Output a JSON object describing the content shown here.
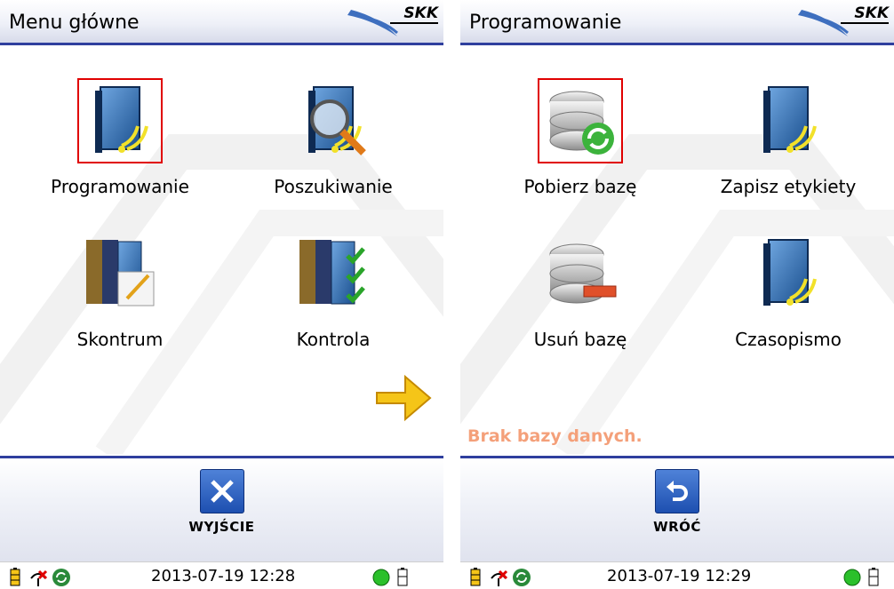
{
  "left": {
    "title": "Menu główne",
    "logo_text": "SKK",
    "tiles": [
      {
        "label": "Programowanie",
        "icon": "book-rfid-icon",
        "selected": true
      },
      {
        "label": "Poszukiwanie",
        "icon": "book-search-icon",
        "selected": false
      },
      {
        "label": "Skontrum",
        "icon": "books-edit-icon",
        "selected": false
      },
      {
        "label": "Kontrola",
        "icon": "books-check-icon",
        "selected": false
      }
    ],
    "next_icon": "arrow-right-icon",
    "bottom_button": {
      "label": "WYJŚCIE",
      "icon": "close-icon"
    },
    "status_datetime": "2013-07-19 12:28"
  },
  "right": {
    "title": "Programowanie",
    "logo_text": "SKK",
    "tiles": [
      {
        "label": "Pobierz bazę",
        "icon": "database-sync-icon",
        "selected": true
      },
      {
        "label": "Zapisz etykiety",
        "icon": "book-rfid-icon",
        "selected": false
      },
      {
        "label": "Usuń bazę",
        "icon": "database-remove-icon",
        "selected": false
      },
      {
        "label": "Czasopismo",
        "icon": "book-rfid-icon",
        "selected": false
      }
    ],
    "message": "Brak bazy danych.",
    "bottom_button": {
      "label": "WRÓĆ",
      "icon": "back-arrow-icon"
    },
    "status_datetime": "2013-07-19 12:29"
  },
  "colors": {
    "accent": "#2f3f9e",
    "selection": "#e00000",
    "message": "#f4a07a",
    "button": "#1d4fb0"
  }
}
